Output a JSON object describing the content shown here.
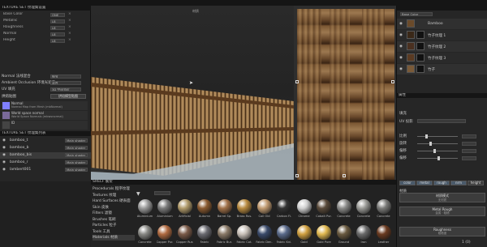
{
  "left_panel": {
    "title": "TEXTURE SET 纹理集设置",
    "props": [
      {
        "label": "Base Color",
        "value": "ONE"
      },
      {
        "label": "Metallic",
        "value": "L8"
      },
      {
        "label": "Roughness",
        "value": "L8"
      },
      {
        "label": "Normal",
        "value": "L8"
      },
      {
        "label": "Height",
        "value": "L8"
      }
    ],
    "normal_label": "Normal 法线混合",
    "normal_value": "细节",
    "ao_label": "Ambient Occlusion 环境光遮蔽",
    "ao_value": "混合",
    "uv_label": "UV 填充",
    "uv_value": "3D 空间邻近",
    "bake_label": "烘焙贴图",
    "bake_button": "烘焙模型贴图",
    "maps": [
      {
        "name": "Normal",
        "desc": "Normal Map from Mesh (mbNormal)"
      },
      {
        "name": "World space normal",
        "desc": "World Space Normals (mbwsnormal)"
      },
      {
        "name": "ID",
        "desc": ""
      }
    ],
    "list_title": "TEXTURE SET 纹理集列表",
    "sets": [
      {
        "name": "bamboo_t",
        "shader": "Main shader"
      },
      {
        "name": "bamboo_b",
        "shader": "Main shader"
      },
      {
        "name": "bamboo_bis",
        "shader": "Main shader"
      },
      {
        "name": "bamboo_r",
        "shader": "Main shader"
      },
      {
        "name": "lambert001",
        "shader": "Main shader"
      }
    ]
  },
  "viewport": {
    "label3d": "材质",
    "label2d": "材质"
  },
  "right_panel": {
    "mode": "Base Color",
    "layers": [
      {
        "name": "Bamboo"
      },
      {
        "name": "竹子纹理 1"
      },
      {
        "name": "竹子纹理 2"
      },
      {
        "name": "竹子纹理 3"
      },
      {
        "name": "竹子"
      }
    ],
    "props_title": "属性",
    "section": "填充",
    "uv_label": "UV 投影",
    "sliders": [
      "比例",
      "旋转",
      "偏移",
      "偏移"
    ],
    "channels": [
      "color",
      "metal",
      "rough",
      "nrm",
      "height"
    ],
    "section2": "材质",
    "btn1": "材质模式",
    "btn1_sub": "无材质",
    "btn2": "Metal Rough",
    "btn2_sub": "金属 · 粗糙",
    "btn3": "Roughness",
    "btn3_sub": "粗糙度",
    "footer": "1 (0)"
  },
  "shelf": {
    "title": "SHELF 展架",
    "categories": [
      "Procedurals 程序纹理",
      "Textures 纹理",
      "Hard Surfaces 硬表面",
      "Skin 皮肤",
      "Filters 滤镜",
      "Brushes 笔刷",
      "Particles 粒子",
      "Tools 工具",
      "Materials 材质"
    ],
    "search_placeholder": "Search...",
    "row1": [
      "Aluminium",
      "Aluminium",
      "Artificial",
      "Autumn",
      "Barrel Sp.",
      "Brass Rus.",
      "Coil Old",
      "Carbon Fi.",
      "Chrome",
      "Cobalt Pur.",
      "Concrete",
      "Concrete",
      "Concrete"
    ],
    "row2": [
      "Concrete",
      "Copper Pur.",
      "Copper Rus.",
      "Fabric",
      "Fabric Bur.",
      "Fabric Cot.",
      "Fabric Den.",
      "Fabric Kni.",
      "Gold",
      "Gold Pure",
      "Ground",
      "Iron",
      "Leather"
    ],
    "row1_colors": [
      "#9a9a9a",
      "#7a7a7a",
      "#b09a6a",
      "#8a5a30",
      "#a07048",
      "#b88a40",
      "#c09a70",
      "#333333",
      "#d0d0d0",
      "#5a4a3a",
      "#8a8a88",
      "#9a9a96",
      "#7a7a78"
    ],
    "row2_colors": [
      "#888884",
      "#b06a40",
      "#7a5a48",
      "#6a6a70",
      "#8a7a68",
      "#c8c0b8",
      "#3a4a6a",
      "#5a6a8a",
      "#d0a040",
      "#e0b850",
      "#6a5a40",
      "#6a6a6a",
      "#6a3a20"
    ]
  }
}
